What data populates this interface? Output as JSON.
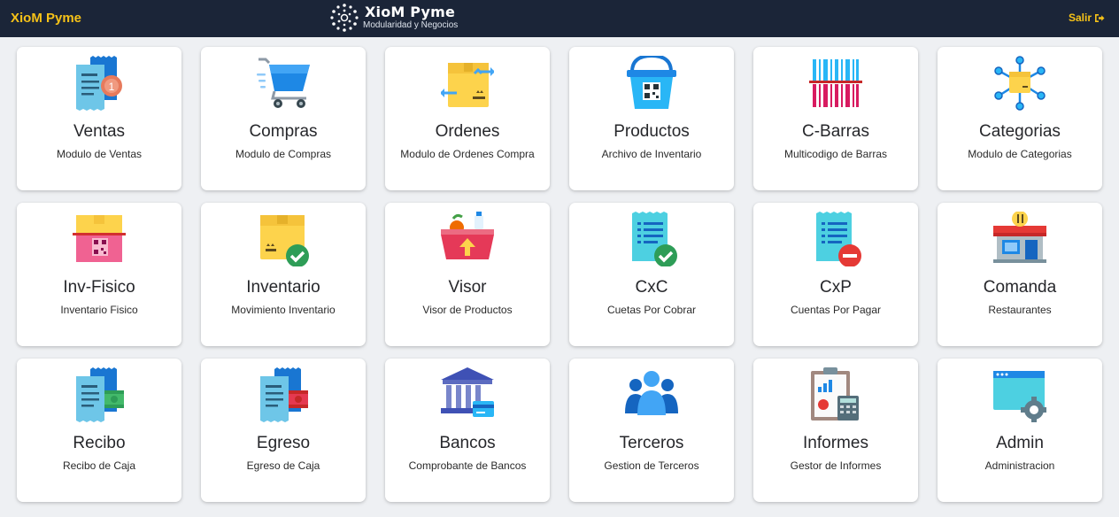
{
  "header": {
    "brand": "XioM Pyme",
    "logo_title": "XioM Pyme",
    "logo_subtitle": "Modularidad y Negocios",
    "exit_label": "Salir"
  },
  "modules": [
    {
      "title": "Ventas",
      "subtitle": "Modulo de Ventas",
      "icon": "sales-receipt-icon"
    },
    {
      "title": "Compras",
      "subtitle": "Modulo de Compras",
      "icon": "shopping-cart-icon"
    },
    {
      "title": "Ordenes",
      "subtitle": "Modulo de Ordenes Compra",
      "icon": "box-transfer-icon"
    },
    {
      "title": "Productos",
      "subtitle": "Archivo de Inventario",
      "icon": "qr-bucket-icon"
    },
    {
      "title": "C-Barras",
      "subtitle": "Multicodigo de Barras",
      "icon": "barcode-icon"
    },
    {
      "title": "Categorias",
      "subtitle": "Modulo de Categorias",
      "icon": "network-box-icon"
    },
    {
      "title": "Inv-Fisico",
      "subtitle": "Inventario Fisico",
      "icon": "qr-box-icon"
    },
    {
      "title": "Inventario",
      "subtitle": "Movimiento Inventario",
      "icon": "box-check-icon"
    },
    {
      "title": "Visor",
      "subtitle": "Visor de Productos",
      "icon": "grocery-basket-icon"
    },
    {
      "title": "CxC",
      "subtitle": "Cuetas Por Cobrar",
      "icon": "document-check-icon"
    },
    {
      "title": "CxP",
      "subtitle": "Cuentas Por Pagar",
      "icon": "document-minus-icon"
    },
    {
      "title": "Comanda",
      "subtitle": "Restaurantes",
      "icon": "restaurant-store-icon"
    },
    {
      "title": "Recibo",
      "subtitle": "Recibo de Caja",
      "icon": "receipt-cash-icon"
    },
    {
      "title": "Egreso",
      "subtitle": "Egreso de Caja",
      "icon": "receipt-expense-icon"
    },
    {
      "title": "Bancos",
      "subtitle": "Comprobante de Bancos",
      "icon": "bank-icon"
    },
    {
      "title": "Terceros",
      "subtitle": "Gestion de Terceros",
      "icon": "people-group-icon"
    },
    {
      "title": "Informes",
      "subtitle": "Gestor de Informes",
      "icon": "report-clipboard-icon"
    },
    {
      "title": "Admin",
      "subtitle": "Administracion",
      "icon": "settings-window-icon"
    }
  ]
}
